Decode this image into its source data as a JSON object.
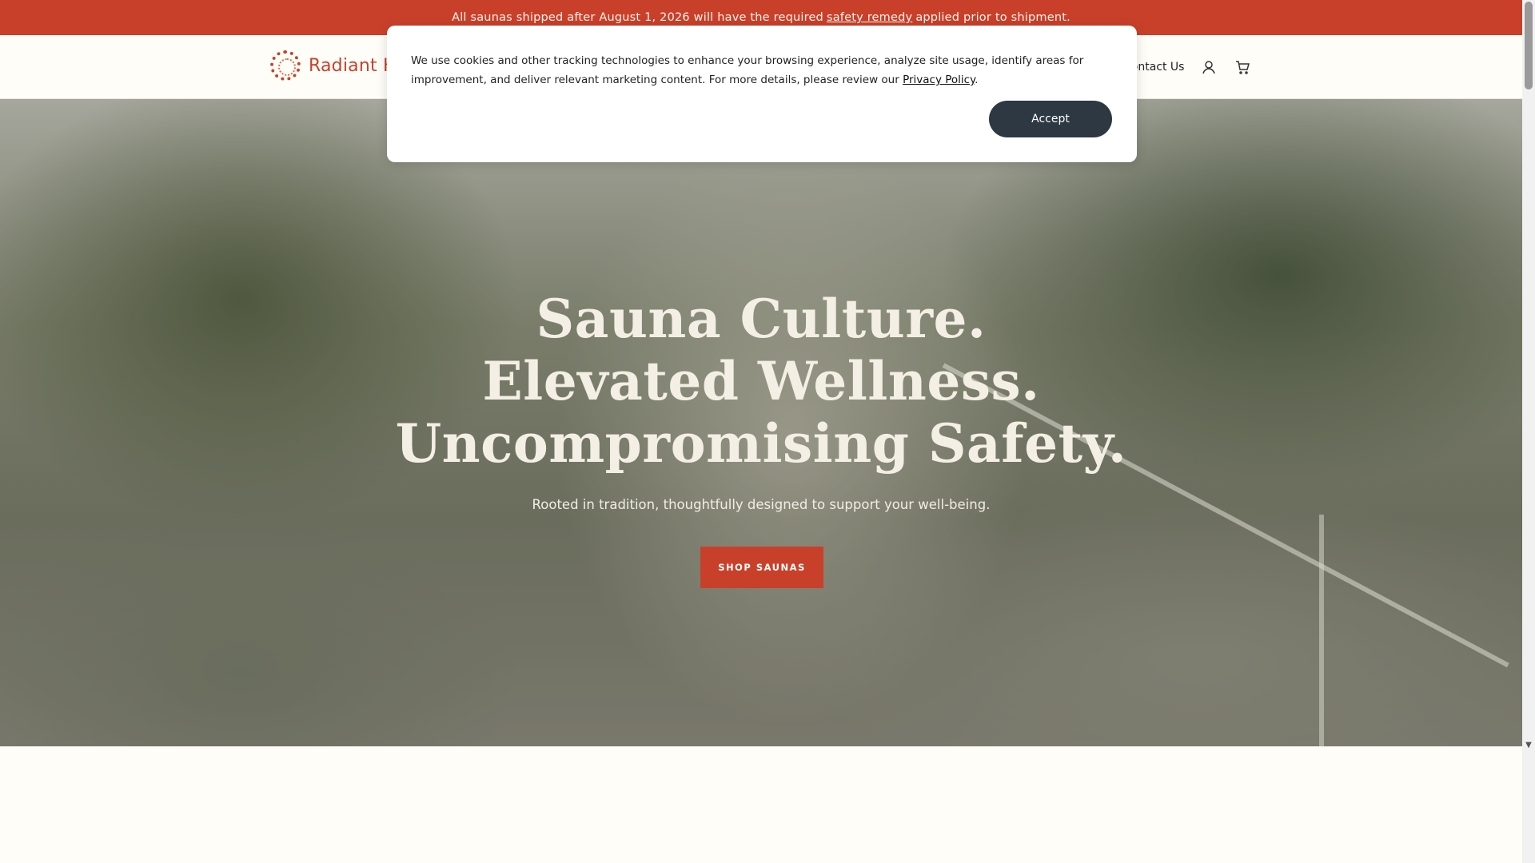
{
  "announcement": {
    "before": "All saunas shipped after August 1, 2026 will have the required",
    "link": "safety remedy",
    "after": "applied prior to shipment."
  },
  "header": {
    "logo_text": "Radiant He",
    "contact_label": "Contact Us",
    "account_icon": "user-icon",
    "cart_icon": "cart-icon"
  },
  "hero": {
    "title_lines": [
      "Sauna Culture.",
      "Elevated Wellness.",
      "Uncompromising Safety."
    ],
    "subtitle": "Rooted in tradition, thoughtfully designed to support your well-being.",
    "cta_label": "SHOP SAUNAS"
  },
  "cookie_banner": {
    "text": "We use cookies and other tracking technologies to enhance your browsing experience, analyze site usage, identify areas for improvement, and deliver relevant marketing content. For more details, please review our",
    "policy_link": "Privacy Policy",
    "trailing": ".",
    "accept_label": "Accept"
  },
  "colors": {
    "brand_red": "#c9402a",
    "accept_dark": "#2d3843",
    "cream": "#fffdf7"
  }
}
